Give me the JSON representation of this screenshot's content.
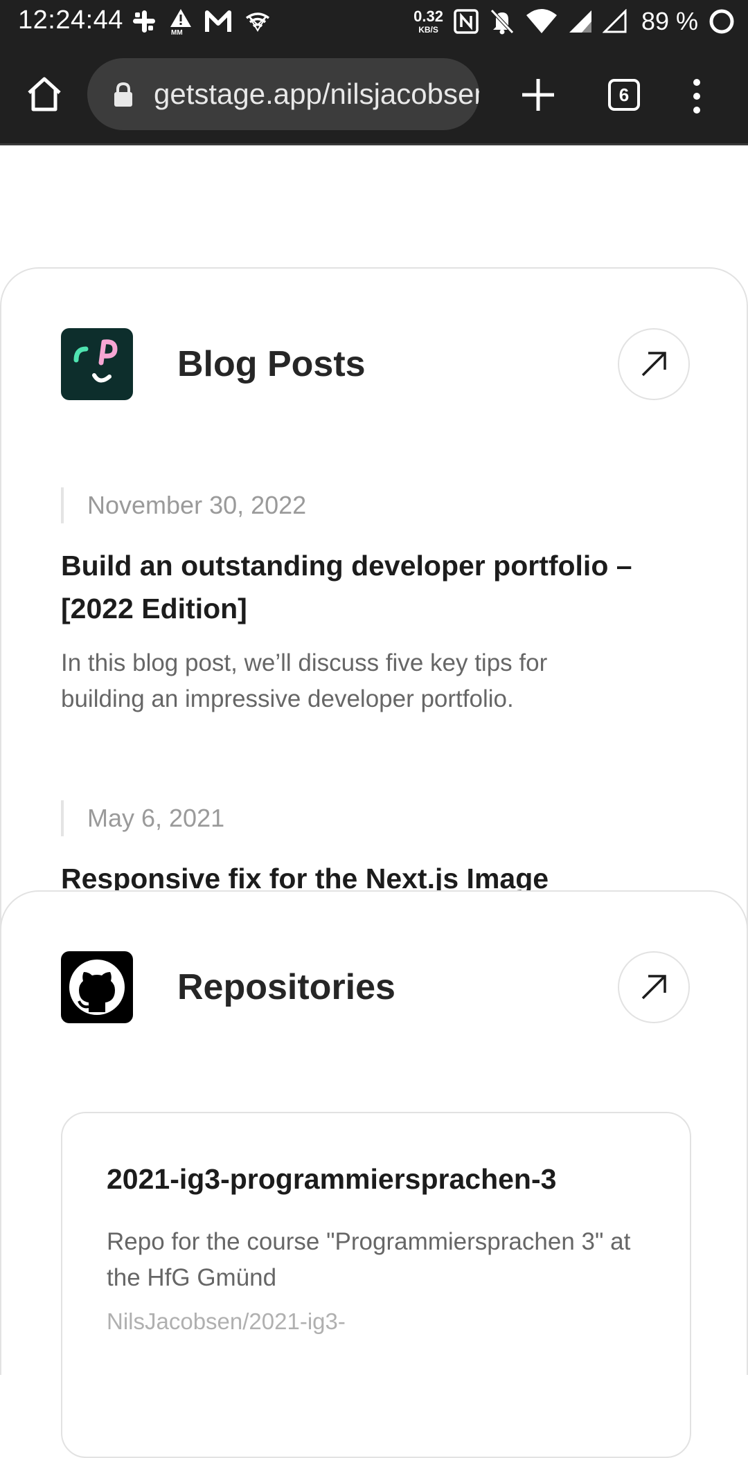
{
  "status_bar": {
    "time": "12:24:44",
    "net_speed_value": "0.32",
    "net_speed_unit": "KB/S",
    "battery": "89 %",
    "icons": [
      "slack-icon",
      "alert-icon",
      "gmail-icon",
      "wireless-icon",
      "nfc-icon",
      "bell-off-icon",
      "wifi-icon",
      "signal-icon",
      "signal-icon",
      "battery-ring-icon"
    ]
  },
  "browser": {
    "url": "getstage.app/nilsjacobsen",
    "tab_count": "6",
    "icons": [
      "home-icon",
      "lock-icon",
      "plus-icon",
      "tabs-icon",
      "more-vert-icon"
    ]
  },
  "blog_card": {
    "title": "Blog Posts",
    "logo_icon": "blog-logo-icon",
    "link_icon": "arrow-up-right-icon",
    "posts": [
      {
        "date": "November 30, 2022",
        "title": "Build an outstanding developer portfolio – [2022 Edition]",
        "excerpt": "In this blog post, we’ll discuss five key tips for building an impressive developer portfolio."
      },
      {
        "date": "May 6, 2021",
        "title": "Responsive fix for the Next.js Image",
        "excerpt": ""
      }
    ]
  },
  "repos_card": {
    "title": "Repositories",
    "logo_icon": "github-icon",
    "link_icon": "arrow-up-right-icon",
    "repos": [
      {
        "name": "2021-ig3-programmiersprachen-3",
        "description": "Repo for the course \"Programmiersprachen 3\" at the HfG Gmünd",
        "path": "NilsJacobsen/2021-ig3-"
      }
    ]
  },
  "colors": {
    "chrome_bg": "#202020",
    "url_pill_bg": "#3c3c3c",
    "card_border": "#e2e2e2",
    "blog_logo_bg": "#0d2e2c",
    "blog_logo_green": "#4fe3b0",
    "blog_logo_pink": "#f6a6d4"
  }
}
